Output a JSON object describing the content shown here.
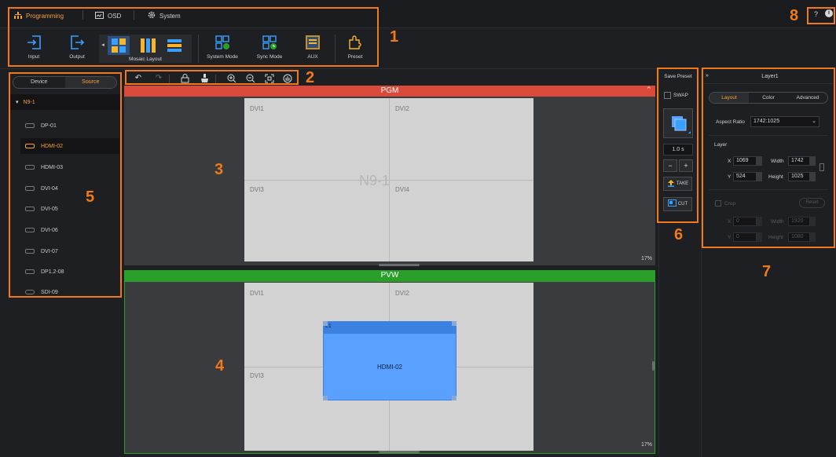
{
  "nav": {
    "tabs": [
      {
        "label": "Programming",
        "icon": "programming-icon",
        "active": true
      },
      {
        "label": "OSD",
        "icon": "osd-icon",
        "active": false
      },
      {
        "label": "System",
        "icon": "gear-icon",
        "active": false
      }
    ],
    "help": "?",
    "info": "i"
  },
  "ribbon": {
    "input": "Input",
    "output": "Output",
    "mosaic_layout": "Mosaic Layout",
    "system_mode": "System Mode",
    "sync_mode": "Sync Mode",
    "aux": "AUX",
    "preset": "Preset"
  },
  "left_panel": {
    "tabs": [
      "Device",
      "Source"
    ],
    "active_tab": "Source",
    "device": "N9-1",
    "sources": [
      "DP-01",
      "HDMI-02",
      "HDMI-03",
      "DVI-04",
      "DVI-05",
      "DVI-06",
      "DVI-07",
      "DP1.2-08",
      "SDI-09"
    ],
    "selected_source": "HDMI-02"
  },
  "pgm": {
    "label": "PGM",
    "cells": [
      "DVI1",
      "DVI2",
      "DVI3",
      "DVI4"
    ],
    "watermark": "N9-1",
    "zoom": "17%"
  },
  "pvw": {
    "label": "PVW",
    "cells": [
      "DVI1",
      "DVI2",
      "DVI3"
    ],
    "layer_tag": "L1",
    "layer_source": "HDMI-02",
    "zoom": "17%"
  },
  "mid_panel": {
    "save_preset": "Save Preset",
    "swap": "SWAP",
    "duration": "1.0 s",
    "minus": "−",
    "plus": "+",
    "take": "TAKE",
    "cut": "CUT"
  },
  "layer_panel": {
    "title": "Layer1",
    "collapse": "»",
    "tabs": [
      "Layout",
      "Color",
      "Advanced"
    ],
    "active_tab": "Layout",
    "aspect_ratio_label": "Aspect Ratio",
    "aspect_ratio_value": "1742:1025",
    "layer_label": "Layer",
    "x_label": "X",
    "x_value": "1069",
    "y_label": "Y",
    "y_value": "524",
    "width_label": "Width",
    "width_value": "1742",
    "height_label": "Height",
    "height_value": "1025",
    "crop_label": "Crop",
    "reset": "Reset",
    "crop_x": "0",
    "crop_y": "0",
    "crop_width": "1920",
    "crop_height": "1080"
  },
  "callouts": [
    "1",
    "2",
    "3",
    "4",
    "5",
    "6",
    "7",
    "8"
  ],
  "colors": {
    "accent": "#f7a13a",
    "pgm_bar": "#d94a3a",
    "pvw_bar": "#2aa02a",
    "layer_fill": "#5aa0ff",
    "annotation": "#f07a1a"
  }
}
